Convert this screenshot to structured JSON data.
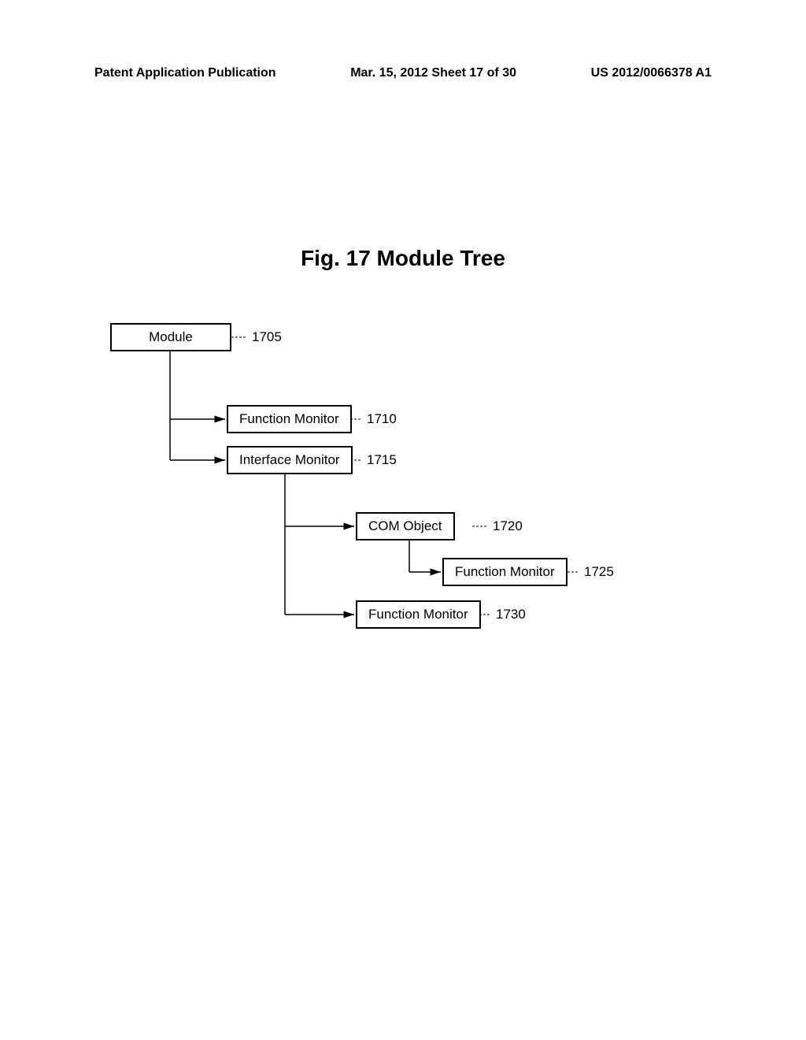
{
  "header": {
    "left": "Patent Application Publication",
    "center": "Mar. 15, 2012  Sheet 17 of 30",
    "right": "US 2012/0066378 A1"
  },
  "figure": {
    "title": "Fig. 17 Module Tree"
  },
  "nodes": {
    "module": {
      "label": "Module",
      "ref": "1705"
    },
    "function_monitor_1": {
      "label": "Function Monitor",
      "ref": "1710"
    },
    "interface_monitor": {
      "label": "Interface Monitor",
      "ref": "1715"
    },
    "com_object": {
      "label": "COM Object",
      "ref": "1720"
    },
    "function_monitor_2": {
      "label": "Function Monitor",
      "ref": "1725"
    },
    "function_monitor_3": {
      "label": "Function Monitor",
      "ref": "1730"
    }
  }
}
